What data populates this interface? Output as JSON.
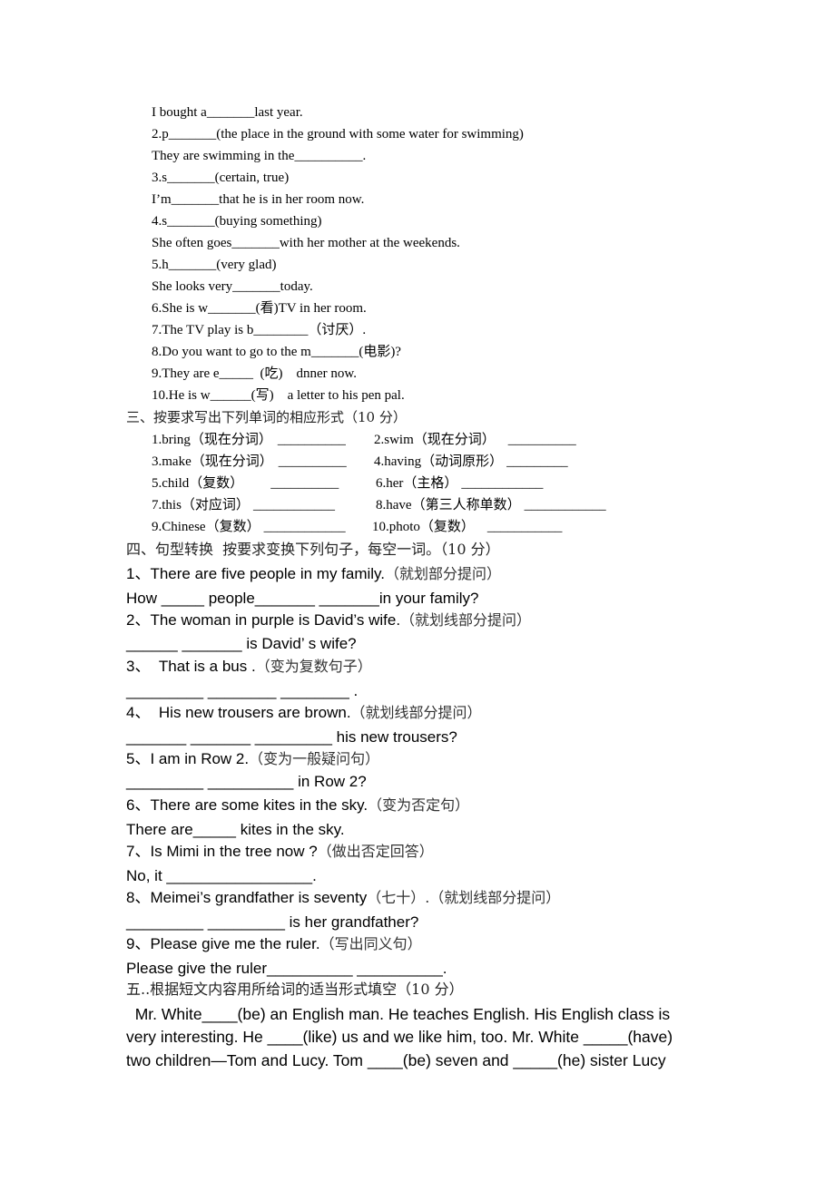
{
  "part2_continued": {
    "lines": [
      "I bought a_______last year.",
      "2.p_______(the place in the ground with some water for swimming)",
      "They are swimming in the__________.",
      "3.s_______(certain, true)",
      "I’m_______that he is in her room now.",
      "4.s_______(buying something)",
      "She often goes_______with her mother at the weekends.",
      "5.h_______(very glad)",
      "She looks very_______today.",
      "6.She is w_______(看)TV in her room.",
      "7.The TV play is b________（讨厌）.",
      "8.Do you want to go to the m_______(电影)?",
      "9.They are e_____  (吃)    dnner now.",
      "10.He is w______(写)    a letter to his pen pal."
    ]
  },
  "section3": {
    "title": "三、按要求写出下列单词的相应形式（10 分）",
    "items": [
      {
        "label": "1.bring（现在分词）",
        "blank": "__________"
      },
      {
        "label": "2.swim（现在分词）",
        "blank": "__________"
      },
      {
        "label": "3.make（现在分词）",
        "blank": "__________"
      },
      {
        "label": "4.having（动词原形）",
        "blank": "_________"
      },
      {
        "label": "5.child（复数）",
        "blank": "__________"
      },
      {
        "label": "6.her（主格）",
        "blank": "____________"
      },
      {
        "label": "7.this（对应词）",
        "blank": "____________"
      },
      {
        "label": "8.have（第三人称单数）",
        "blank": "____________"
      },
      {
        "label": "9.Chinese（复数）",
        "blank": "____________"
      },
      {
        "label": "10.photo（复数）",
        "blank": "___________"
      }
    ]
  },
  "section4": {
    "title": "四、句型转换  按要求变换下列句子，每空一词。（10 分）",
    "questions": [
      {
        "prompt": "1、There are five people in my family.",
        "instruction": "（就划部分提问）",
        "answer": "How _____ people_______ _______in your family?"
      },
      {
        "prompt": "2、The woman in purple is David’s wife.",
        "instruction": "（就划线部分提问）",
        "answer": "______ _______ is David’ s wife?"
      },
      {
        "prompt": "3、  That is a bus .",
        "instruction": "（变为复数句子）",
        "answer": "_________ ________ ________ ."
      },
      {
        "prompt": "4、  His new trousers are brown.",
        "instruction": "（就划线部分提问）",
        "answer": "_______ _______ _________ his new trousers?"
      },
      {
        "prompt": "5、I am in Row 2.",
        "instruction": "（变为一般疑问句）",
        "answer": "_________ __________ in Row 2?"
      },
      {
        "prompt": "6、There are some kites in the sky.",
        "instruction": "（变为否定句）",
        "answer": "There are_____ kites in the sky."
      },
      {
        "prompt": "7、Is Mimi in the tree now ?",
        "instruction": "（做出否定回答）",
        "answer": "No, it _________________."
      },
      {
        "prompt": "8、Meimei’s grandfather is seventy",
        "instruction": "（七十）.（就划线部分提问）",
        "answer": "_________ _________ is her grandfather?"
      },
      {
        "prompt": "9、Please give me the ruler.",
        "instruction": "（写出同义句）",
        "answer": "Please give the ruler__________ __________."
      }
    ]
  },
  "section5": {
    "title": "五..根据短文内容用所给词的适当形式填空（10 分）",
    "passage_lines": [
      "  Mr. White____(be) an English man. He teaches English. His English class is",
      "very interesting. He ____(like) us and we like him, too. Mr. White _____(have)",
      "two children—Tom and Lucy. Tom ____(be) seven and _____(he) sister Lucy"
    ]
  }
}
